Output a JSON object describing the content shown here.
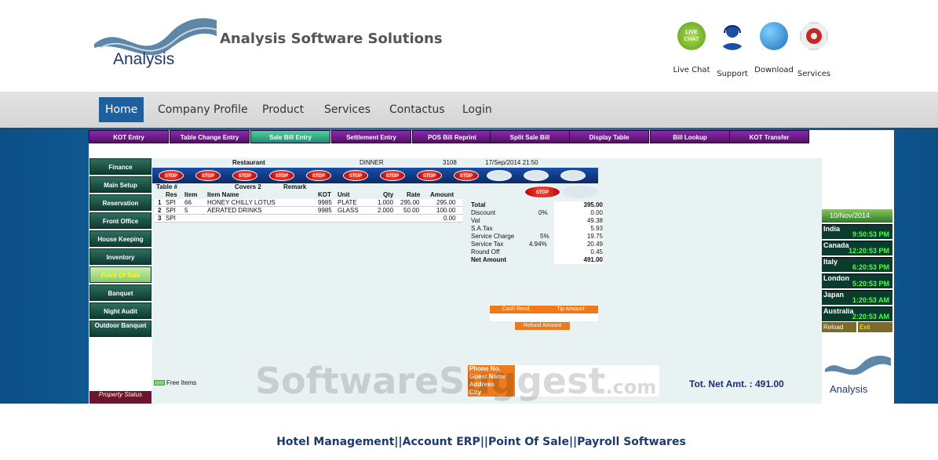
{
  "header": {
    "logo_text": "Analysis",
    "company_name": "Analysis Software Solutions",
    "quick_links": [
      {
        "label": "Live Chat",
        "icon": "live-chat-icon",
        "icon_text": "LIVE CHAT"
      },
      {
        "label": "Support",
        "icon": "support-headset-icon"
      },
      {
        "label": "Download",
        "icon": "globe-download-icon"
      },
      {
        "label": "Services",
        "icon": "gear-services-icon"
      }
    ]
  },
  "nav": {
    "items": [
      "Home",
      "Company Profile",
      "Product",
      "Services",
      "Contactus",
      "Login"
    ]
  },
  "app": {
    "top_tabs": [
      "KOT Entry",
      "Table Change Entry",
      "Sale Bill Entry",
      "Settlement Entry",
      "POS Bill Reprint",
      "Split Sale Bill",
      "Display Table",
      "Bill Lookup",
      "KOT Transfer"
    ],
    "side_menu": [
      "Finance",
      "Main Setup",
      "Reservation",
      "Front Office",
      "House Keeping",
      "Inventory",
      "Point Of Sale",
      "Banquet",
      "Night Audit",
      "Outdoor Banquet"
    ],
    "property_status": "Property Status",
    "info": {
      "section": "Restaurant",
      "meal": "DINNER",
      "bill_no": "3108",
      "datetime": "17/Sep/2014 21:50"
    },
    "stop_label": "STOP",
    "table": {
      "table_label": "Table #",
      "covers": "Covers 2",
      "remark": "Remark",
      "headers": [
        "Res",
        "Item",
        "Item Name",
        "KOT",
        "Unit",
        "Qty",
        "Rate",
        "Amount"
      ],
      "rows": [
        {
          "n": "1",
          "res": "SPI",
          "item": "66",
          "name": "HONEY CHILLY LOTUS",
          "kot": "9985",
          "unit": "PLATE",
          "qty": "1.000",
          "rate": "295.00",
          "amount": "295.00"
        },
        {
          "n": "2",
          "res": "SPI",
          "item": "5",
          "name": "AERATED DRINKS",
          "kot": "9985",
          "unit": "GLASS",
          "qty": "2.000",
          "rate": "50.00",
          "amount": "100.00"
        },
        {
          "n": "3",
          "res": "SPI",
          "item": "",
          "name": "",
          "kot": "",
          "unit": "",
          "qty": "",
          "rate": "",
          "amount": "0.00"
        }
      ]
    },
    "totals": [
      {
        "label": "Total",
        "pct": "",
        "value": "395.00",
        "bold": true
      },
      {
        "label": "Discount",
        "pct": "0%",
        "value": "0.00"
      },
      {
        "label": "Vat",
        "pct": "",
        "value": "49.38"
      },
      {
        "label": "S.A.Tax",
        "pct": "",
        "value": "5.93"
      },
      {
        "label": "Service Charge",
        "pct": "5%",
        "value": "19.75"
      },
      {
        "label": "Service Tax",
        "pct": "4.94%",
        "value": "20.49"
      },
      {
        "label": "Round Off",
        "pct": "",
        "value": "0.45"
      },
      {
        "label": "Net Amount",
        "pct": "",
        "value": "491.00",
        "bold": true
      }
    ],
    "cash_recd": "Cash Recd.",
    "tip_amount": "Tip Amount",
    "refund_amount": "Refund Amount",
    "guest_fields": [
      "Phone No.",
      "Guest Name",
      "Address",
      "City"
    ],
    "free_items": "Free Items",
    "total_net": "Tot. Net Amt. : 491.00",
    "date": "10/Nov/2014",
    "clocks": [
      {
        "city": "India",
        "time": "9:50:53 PM"
      },
      {
        "city": "Canada",
        "time": "12:20:53 PM"
      },
      {
        "city": "Italy",
        "time": "6:20:53 PM"
      },
      {
        "city": "London",
        "time": "5:20:53 PM"
      },
      {
        "city": "Japan",
        "time": "1:20:53 AM"
      },
      {
        "city": "Australia",
        "time": "2:20:53 AM"
      }
    ],
    "reload": "Reload",
    "exit": "Exit",
    "logo_small": "Analysis"
  },
  "watermark": {
    "main": "SoftwareSuggest",
    "suffix": ".com"
  },
  "footer": "Hotel Management||Account ERP||Point Of Sale||Payroll Softwares"
}
